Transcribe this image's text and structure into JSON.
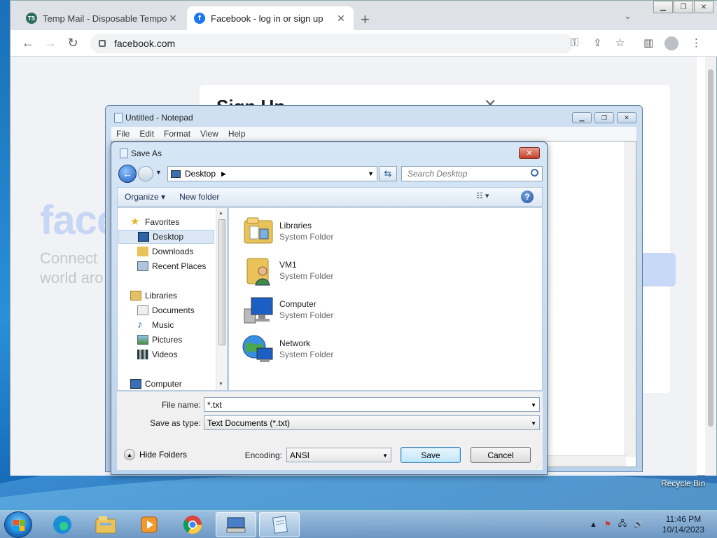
{
  "browser": {
    "tabs": [
      {
        "label": "Temp Mail - Disposable Tempora",
        "favicon": "temp-mail-icon"
      },
      {
        "label": "Facebook - log in or sign up",
        "favicon": "facebook-icon"
      }
    ],
    "url": "facebook.com"
  },
  "facebook_page": {
    "logo": "face",
    "tagline": "Connect world aro",
    "signup_heading": "Sign Up",
    "close_glyph": "✕"
  },
  "notepad": {
    "title": "Untitled - Notepad",
    "menu": [
      "File",
      "Edit",
      "Format",
      "View",
      "Help"
    ]
  },
  "save_as": {
    "title": "Save As",
    "location": "Desktop",
    "search_placeholder": "Search Desktop",
    "toolbar": {
      "organize": "Organize ▾",
      "new_folder": "New folder"
    },
    "nav": {
      "favorites": "Favorites",
      "desktop": "Desktop",
      "downloads": "Downloads",
      "recent_places": "Recent Places",
      "libraries": "Libraries",
      "documents": "Documents",
      "music": "Music",
      "pictures": "Pictures",
      "videos": "Videos",
      "computer": "Computer"
    },
    "files": [
      {
        "name": "Libraries",
        "type": "System Folder",
        "icon": "libraries-icon"
      },
      {
        "name": "VM1",
        "type": "System Folder",
        "icon": "user-folder-icon"
      },
      {
        "name": "Computer",
        "type": "System Folder",
        "icon": "computer-icon"
      },
      {
        "name": "Network",
        "type": "System Folder",
        "icon": "network-icon"
      }
    ],
    "file_name_label": "File name:",
    "file_name_value": "*.txt",
    "save_type_label": "Save as type:",
    "save_type_value": "Text Documents (*.txt)",
    "encoding_label": "Encoding:",
    "encoding_value": "ANSI",
    "hide_folders": "Hide Folders",
    "save_button": "Save",
    "cancel_button": "Cancel"
  },
  "desktop": {
    "recycle_bin": "Recycle Bin"
  },
  "taskbar": {
    "time": "11:46 PM",
    "date": "10/14/2023"
  }
}
